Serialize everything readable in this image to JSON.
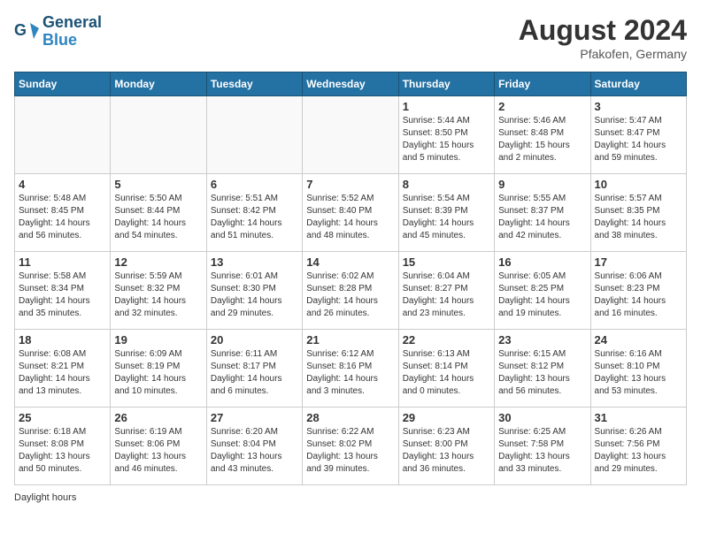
{
  "header": {
    "logo_line1": "General",
    "logo_line2": "Blue",
    "month_year": "August 2024",
    "location": "Pfakofen, Germany"
  },
  "days_of_week": [
    "Sunday",
    "Monday",
    "Tuesday",
    "Wednesday",
    "Thursday",
    "Friday",
    "Saturday"
  ],
  "weeks": [
    [
      {
        "day": "",
        "sunrise": "",
        "sunset": "",
        "daylight": ""
      },
      {
        "day": "",
        "sunrise": "",
        "sunset": "",
        "daylight": ""
      },
      {
        "day": "",
        "sunrise": "",
        "sunset": "",
        "daylight": ""
      },
      {
        "day": "",
        "sunrise": "",
        "sunset": "",
        "daylight": ""
      },
      {
        "day": "1",
        "sunrise": "Sunrise: 5:44 AM",
        "sunset": "Sunset: 8:50 PM",
        "daylight": "Daylight: 15 hours and 5 minutes."
      },
      {
        "day": "2",
        "sunrise": "Sunrise: 5:46 AM",
        "sunset": "Sunset: 8:48 PM",
        "daylight": "Daylight: 15 hours and 2 minutes."
      },
      {
        "day": "3",
        "sunrise": "Sunrise: 5:47 AM",
        "sunset": "Sunset: 8:47 PM",
        "daylight": "Daylight: 14 hours and 59 minutes."
      }
    ],
    [
      {
        "day": "4",
        "sunrise": "Sunrise: 5:48 AM",
        "sunset": "Sunset: 8:45 PM",
        "daylight": "Daylight: 14 hours and 56 minutes."
      },
      {
        "day": "5",
        "sunrise": "Sunrise: 5:50 AM",
        "sunset": "Sunset: 8:44 PM",
        "daylight": "Daylight: 14 hours and 54 minutes."
      },
      {
        "day": "6",
        "sunrise": "Sunrise: 5:51 AM",
        "sunset": "Sunset: 8:42 PM",
        "daylight": "Daylight: 14 hours and 51 minutes."
      },
      {
        "day": "7",
        "sunrise": "Sunrise: 5:52 AM",
        "sunset": "Sunset: 8:40 PM",
        "daylight": "Daylight: 14 hours and 48 minutes."
      },
      {
        "day": "8",
        "sunrise": "Sunrise: 5:54 AM",
        "sunset": "Sunset: 8:39 PM",
        "daylight": "Daylight: 14 hours and 45 minutes."
      },
      {
        "day": "9",
        "sunrise": "Sunrise: 5:55 AM",
        "sunset": "Sunset: 8:37 PM",
        "daylight": "Daylight: 14 hours and 42 minutes."
      },
      {
        "day": "10",
        "sunrise": "Sunrise: 5:57 AM",
        "sunset": "Sunset: 8:35 PM",
        "daylight": "Daylight: 14 hours and 38 minutes."
      }
    ],
    [
      {
        "day": "11",
        "sunrise": "Sunrise: 5:58 AM",
        "sunset": "Sunset: 8:34 PM",
        "daylight": "Daylight: 14 hours and 35 minutes."
      },
      {
        "day": "12",
        "sunrise": "Sunrise: 5:59 AM",
        "sunset": "Sunset: 8:32 PM",
        "daylight": "Daylight: 14 hours and 32 minutes."
      },
      {
        "day": "13",
        "sunrise": "Sunrise: 6:01 AM",
        "sunset": "Sunset: 8:30 PM",
        "daylight": "Daylight: 14 hours and 29 minutes."
      },
      {
        "day": "14",
        "sunrise": "Sunrise: 6:02 AM",
        "sunset": "Sunset: 8:28 PM",
        "daylight": "Daylight: 14 hours and 26 minutes."
      },
      {
        "day": "15",
        "sunrise": "Sunrise: 6:04 AM",
        "sunset": "Sunset: 8:27 PM",
        "daylight": "Daylight: 14 hours and 23 minutes."
      },
      {
        "day": "16",
        "sunrise": "Sunrise: 6:05 AM",
        "sunset": "Sunset: 8:25 PM",
        "daylight": "Daylight: 14 hours and 19 minutes."
      },
      {
        "day": "17",
        "sunrise": "Sunrise: 6:06 AM",
        "sunset": "Sunset: 8:23 PM",
        "daylight": "Daylight: 14 hours and 16 minutes."
      }
    ],
    [
      {
        "day": "18",
        "sunrise": "Sunrise: 6:08 AM",
        "sunset": "Sunset: 8:21 PM",
        "daylight": "Daylight: 14 hours and 13 minutes."
      },
      {
        "day": "19",
        "sunrise": "Sunrise: 6:09 AM",
        "sunset": "Sunset: 8:19 PM",
        "daylight": "Daylight: 14 hours and 10 minutes."
      },
      {
        "day": "20",
        "sunrise": "Sunrise: 6:11 AM",
        "sunset": "Sunset: 8:17 PM",
        "daylight": "Daylight: 14 hours and 6 minutes."
      },
      {
        "day": "21",
        "sunrise": "Sunrise: 6:12 AM",
        "sunset": "Sunset: 8:16 PM",
        "daylight": "Daylight: 14 hours and 3 minutes."
      },
      {
        "day": "22",
        "sunrise": "Sunrise: 6:13 AM",
        "sunset": "Sunset: 8:14 PM",
        "daylight": "Daylight: 14 hours and 0 minutes."
      },
      {
        "day": "23",
        "sunrise": "Sunrise: 6:15 AM",
        "sunset": "Sunset: 8:12 PM",
        "daylight": "Daylight: 13 hours and 56 minutes."
      },
      {
        "day": "24",
        "sunrise": "Sunrise: 6:16 AM",
        "sunset": "Sunset: 8:10 PM",
        "daylight": "Daylight: 13 hours and 53 minutes."
      }
    ],
    [
      {
        "day": "25",
        "sunrise": "Sunrise: 6:18 AM",
        "sunset": "Sunset: 8:08 PM",
        "daylight": "Daylight: 13 hours and 50 minutes."
      },
      {
        "day": "26",
        "sunrise": "Sunrise: 6:19 AM",
        "sunset": "Sunset: 8:06 PM",
        "daylight": "Daylight: 13 hours and 46 minutes."
      },
      {
        "day": "27",
        "sunrise": "Sunrise: 6:20 AM",
        "sunset": "Sunset: 8:04 PM",
        "daylight": "Daylight: 13 hours and 43 minutes."
      },
      {
        "day": "28",
        "sunrise": "Sunrise: 6:22 AM",
        "sunset": "Sunset: 8:02 PM",
        "daylight": "Daylight: 13 hours and 39 minutes."
      },
      {
        "day": "29",
        "sunrise": "Sunrise: 6:23 AM",
        "sunset": "Sunset: 8:00 PM",
        "daylight": "Daylight: 13 hours and 36 minutes."
      },
      {
        "day": "30",
        "sunrise": "Sunrise: 6:25 AM",
        "sunset": "Sunset: 7:58 PM",
        "daylight": "Daylight: 13 hours and 33 minutes."
      },
      {
        "day": "31",
        "sunrise": "Sunrise: 6:26 AM",
        "sunset": "Sunset: 7:56 PM",
        "daylight": "Daylight: 13 hours and 29 minutes."
      }
    ]
  ],
  "footer": {
    "label": "Daylight hours"
  }
}
